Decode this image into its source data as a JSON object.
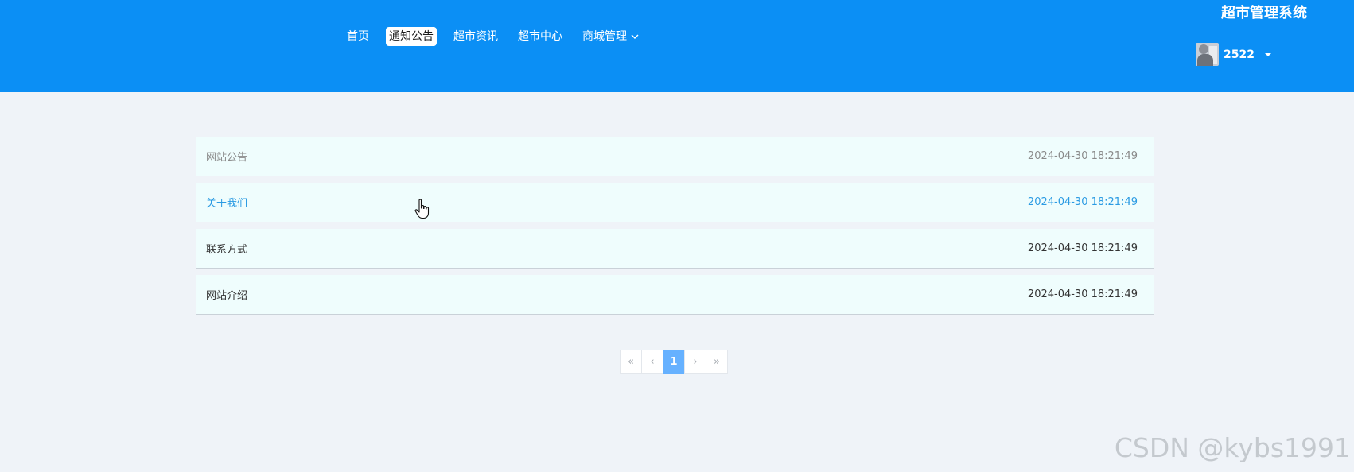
{
  "header": {
    "site_title": "超市管理系统",
    "nav": [
      {
        "label": "首页",
        "active": false
      },
      {
        "label": "通知公告",
        "active": true
      },
      {
        "label": "超市资讯",
        "active": false
      },
      {
        "label": "超市中心",
        "active": false
      },
      {
        "label": "商城管理",
        "active": false,
        "has_dropdown": true
      }
    ],
    "user": {
      "name": "2522",
      "avatar_icon": "user-avatar-photo"
    }
  },
  "notices": [
    {
      "title": "网站公告",
      "date": "2024-04-30 18:21:49"
    },
    {
      "title": "关于我们",
      "date": "2024-04-30 18:21:49"
    },
    {
      "title": "联系方式",
      "date": "2024-04-30 18:21:49"
    },
    {
      "title": "网站介绍",
      "date": "2024-04-30 18:21:49"
    }
  ],
  "pagination": {
    "first": "«",
    "prev": "‹",
    "current": "1",
    "next": "›",
    "last": "»"
  },
  "watermark": "CSDN @kybs1991",
  "colors": {
    "header_bg": "#0b8ff5",
    "page_bg": "#eff3f8",
    "row_bg": "#effdfd",
    "link_hover": "#2b9be3",
    "page_current": "#66b1ff"
  }
}
